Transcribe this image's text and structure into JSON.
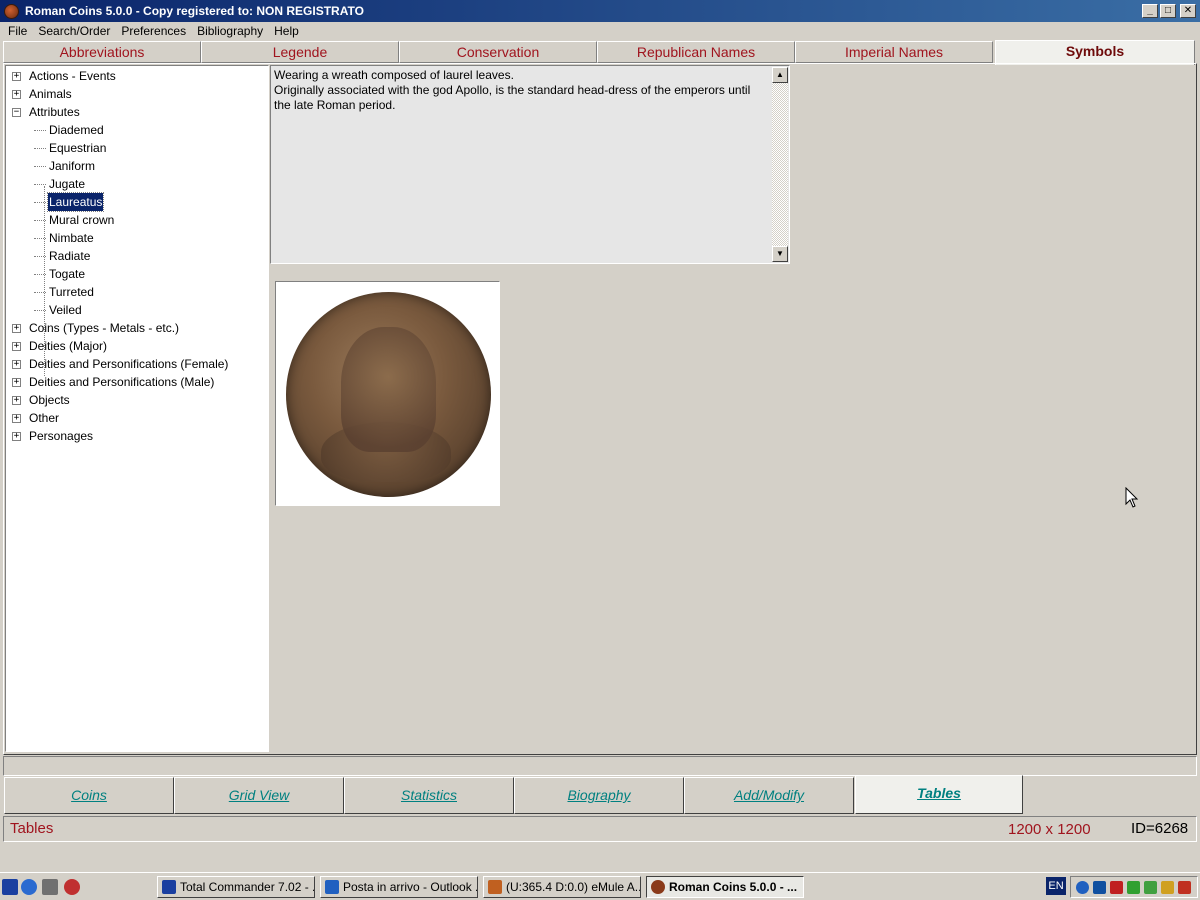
{
  "window": {
    "title": "Roman Coins 5.0.0 - Copy registered to:  NON REGISTRATO",
    "controls": {
      "minimize": "_",
      "maximize": "□",
      "close": "✕"
    }
  },
  "menu": [
    "File",
    "Search/Order",
    "Preferences",
    "Bibliography",
    "Help"
  ],
  "top_tabs": [
    {
      "label": "Abbreviations",
      "active": false
    },
    {
      "label": "Legende",
      "active": false
    },
    {
      "label": "Conservation",
      "active": false
    },
    {
      "label": "Republican Names",
      "active": false
    },
    {
      "label": "Imperial Names",
      "active": false
    },
    {
      "label": "Symbols",
      "active": true
    }
  ],
  "tree": {
    "expander_collapsed": "+",
    "expander_expanded": "−",
    "groups_before": [
      {
        "label": "Actions - Events",
        "expanded": false
      },
      {
        "label": "Animals",
        "expanded": false
      }
    ],
    "open_group": {
      "label": "Attributes",
      "expanded": true,
      "children": [
        "Diademed",
        "Equestrian",
        "Janiform",
        "Jugate",
        "Laureatus",
        "Mural crown",
        "Nimbate",
        "Radiate",
        "Togate",
        "Turreted",
        "Veiled"
      ],
      "selected": "Laureatus"
    },
    "groups_after": [
      {
        "label": "Coins (Types - Metals - etc.)",
        "expanded": false
      },
      {
        "label": "Deities (Major)",
        "expanded": false
      },
      {
        "label": "Deities and Personifications (Female)",
        "expanded": false
      },
      {
        "label": "Deities and Personifications (Male)",
        "expanded": false
      },
      {
        "label": "Objects",
        "expanded": false
      },
      {
        "label": "Other",
        "expanded": false
      },
      {
        "label": "Personages",
        "expanded": false
      }
    ]
  },
  "description": {
    "lines": [
      "Wearing a wreath composed of laurel leaves.",
      "Originally associated with the god Apollo, is the standard head-dress of the emperors until",
      "the late Roman period."
    ],
    "scroll_up": "▲",
    "scroll_down": "▼"
  },
  "image": {
    "icon": "coin-image"
  },
  "bottom_tabs": [
    {
      "label": "Coins",
      "active": false
    },
    {
      "label": "Grid View",
      "active": false
    },
    {
      "label": "Statistics",
      "active": false
    },
    {
      "label": "Biography",
      "active": false
    },
    {
      "label": "Add/Modify",
      "active": false
    },
    {
      "label": "Tables",
      "active": true
    }
  ],
  "status": {
    "left": "Tables",
    "size": "1200 x 1200",
    "id": "ID=6268"
  },
  "taskbar": {
    "buttons": [
      {
        "label": "Total Commander 7.02 - ...",
        "icon_color": "#1a3fa0",
        "active": false
      },
      {
        "label": "Posta in arrivo - Outlook ...",
        "icon_color": "#2060c0",
        "active": false
      },
      {
        "label": "(U:365.4 D:0.0) eMule A...",
        "icon_color": "#c06020",
        "active": false
      },
      {
        "label": "Roman Coins 5.0.0 - ...",
        "icon_color": "#8a3a1a",
        "active": true
      }
    ],
    "language": "EN",
    "quicklaunch_colors": [
      "#1a3fa0",
      "#2a6ad0",
      "#707070",
      "#c03030"
    ],
    "tray_colors": [
      "#2060c0",
      "#1050a0",
      "#c02020",
      "#30a030",
      "#40a040",
      "#d0a020",
      "#c03020"
    ]
  },
  "colors": {
    "tab_text": "#a0141e",
    "bottom_tab_text": "#008080",
    "selection": "#0a246a",
    "title_bar": "#0a246a"
  }
}
